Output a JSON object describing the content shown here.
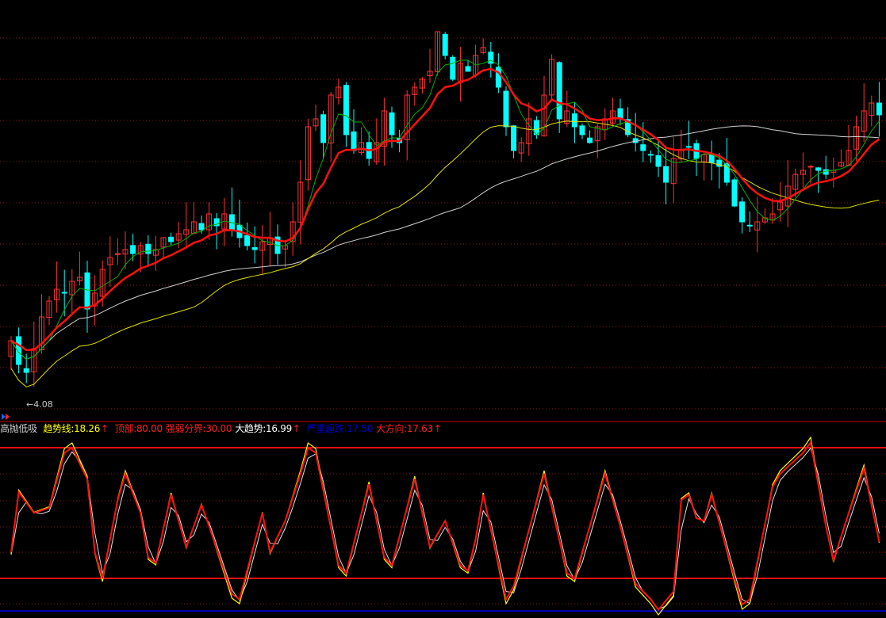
{
  "indicator": {
    "name": "高抛低吸",
    "items": [
      {
        "label": "趋势线:18.26",
        "color": "#ffff00",
        "arrow": "↑"
      },
      {
        "label": "顶部:80.00",
        "color": "#ff2020",
        "arrow": ""
      },
      {
        "label": "强弱分界:30.00",
        "color": "#ff2020",
        "arrow": ""
      },
      {
        "label": "大趋势:16.99",
        "color": "#ffffff",
        "arrow": "↑"
      },
      {
        "label": "严重超跌:17.50",
        "color": "#0000c8",
        "arrow": ""
      },
      {
        "label": "大方向:17.63",
        "color": "#ff2020",
        "arrow": "↑"
      }
    ]
  },
  "low_marker": "←4.08",
  "colors": {
    "up": "#ff3232",
    "down": "#00ffff",
    "ma_fast": "#00b000",
    "ma_mid": "#ff1010",
    "ma_yellow": "#e0e000",
    "ma_slow": "#d0d0d0",
    "grid": "#8b1a1a"
  },
  "chart_data": [
    {
      "type": "candlestick",
      "title": "price",
      "price_min_label": 4.08,
      "closes": [
        4.68,
        4.38,
        4.28,
        4.58,
        4.98,
        5.18,
        5.33,
        5.28,
        5.43,
        5.48,
        5.08,
        5.28,
        5.58,
        5.73,
        5.78,
        5.83,
        5.78,
        5.88,
        5.78,
        5.83,
        5.98,
        5.93,
        6.03,
        6.08,
        6.18,
        6.08,
        6.28,
        6.13,
        6.28,
        6.08,
        5.98,
        5.88,
        5.83,
        5.93,
        5.98,
        5.78,
        5.88,
        6.18,
        6.68,
        7.38,
        7.48,
        7.18,
        7.78,
        7.88,
        7.28,
        7.08,
        7.18,
        6.98,
        7.18,
        7.58,
        7.28,
        7.18,
        7.78,
        7.88,
        7.98,
        8.08,
        8.58,
        8.28,
        7.98,
        8.18,
        8.08,
        8.28,
        8.38,
        8.18,
        7.88,
        7.38,
        7.08,
        7.18,
        7.48,
        7.28,
        7.78,
        8.23,
        7.48,
        7.58,
        7.38,
        7.28,
        7.18,
        7.38,
        7.48,
        7.58,
        7.48,
        7.28,
        7.18,
        7.08,
        7.03,
        6.88,
        6.68,
        6.98,
        7.08,
        7.13,
        6.98,
        7.03,
        6.93,
        6.88,
        6.68,
        6.38,
        6.18,
        6.13,
        6.18,
        6.23,
        6.28,
        6.43,
        6.63,
        6.78,
        6.83,
        6.88,
        6.83,
        6.78,
        6.83,
        6.93,
        7.08,
        7.38,
        7.58,
        7.68,
        7.53
      ],
      "moving_averages": [
        "MA fast (green)",
        "EMA (red)",
        "step MA (yellow)",
        "long MA (white)"
      ]
    },
    {
      "type": "line",
      "title": "高抛低吸",
      "ylim": [
        17.5,
        87
      ],
      "reference_lines": [
        {
          "label": "顶部",
          "value": 80
        },
        {
          "label": "强弱分界",
          "value": 30
        },
        {
          "label": "严重超跌",
          "value": 17.5
        }
      ],
      "keypoints_bar_value": [
        [
          0,
          40
        ],
        [
          1,
          63
        ],
        [
          3,
          55
        ],
        [
          5,
          57
        ],
        [
          7,
          78
        ],
        [
          8,
          80
        ],
        [
          10,
          68
        ],
        [
          11,
          40
        ],
        [
          12,
          30
        ],
        [
          14,
          60
        ],
        [
          15,
          70
        ],
        [
          17,
          55
        ],
        [
          18,
          38
        ],
        [
          19,
          36
        ],
        [
          21,
          62
        ],
        [
          23,
          42
        ],
        [
          25,
          58
        ],
        [
          26,
          50
        ],
        [
          29,
          24
        ],
        [
          30,
          22
        ],
        [
          33,
          55
        ],
        [
          34,
          40
        ],
        [
          36,
          52
        ],
        [
          38,
          70
        ],
        [
          39,
          80
        ],
        [
          40,
          78
        ],
        [
          43,
          35
        ],
        [
          44,
          32
        ],
        [
          47,
          66
        ],
        [
          49,
          38
        ],
        [
          50,
          35
        ],
        [
          53,
          68
        ],
        [
          55,
          42
        ],
        [
          57,
          52
        ],
        [
          59,
          35
        ],
        [
          60,
          33
        ],
        [
          61,
          45
        ],
        [
          62,
          62
        ],
        [
          65,
          22
        ],
        [
          66,
          27
        ],
        [
          70,
          70
        ],
        [
          73,
          32
        ],
        [
          74,
          30
        ],
        [
          78,
          70
        ],
        [
          80,
          50
        ],
        [
          82,
          28
        ],
        [
          84,
          22
        ],
        [
          85,
          18
        ],
        [
          87,
          25
        ],
        [
          88,
          60
        ],
        [
          89,
          62
        ],
        [
          90,
          53
        ],
        [
          91,
          52
        ],
        [
          92,
          62
        ],
        [
          95,
          30
        ],
        [
          96,
          20
        ],
        [
          97,
          22
        ],
        [
          100,
          65
        ],
        [
          101,
          70
        ],
        [
          104,
          78
        ],
        [
          105,
          82
        ],
        [
          107,
          50
        ],
        [
          108,
          37
        ],
        [
          110,
          55
        ],
        [
          112,
          72
        ],
        [
          113,
          58
        ],
        [
          114,
          44
        ]
      ]
    }
  ]
}
